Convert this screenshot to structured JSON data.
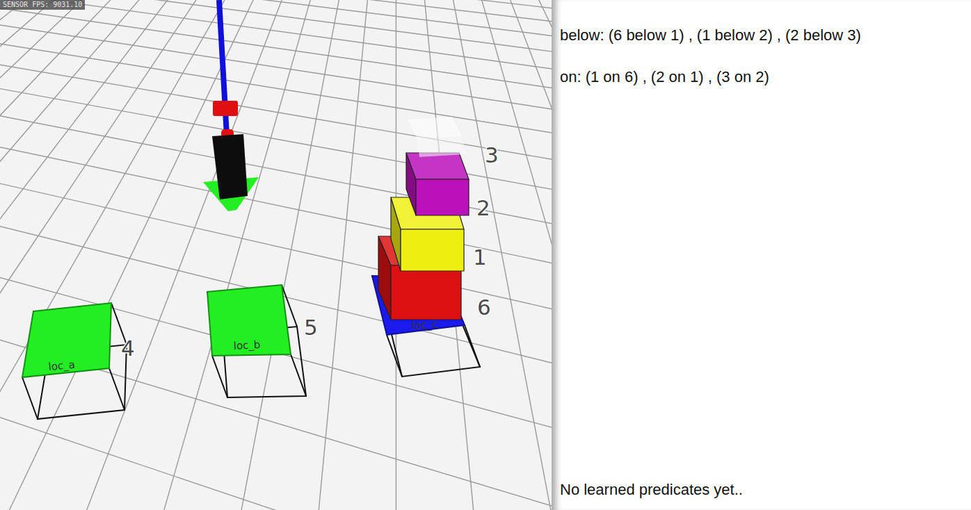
{
  "overlay": {
    "sensor_fps": "SENSOR FPS: 9031.10"
  },
  "scene": {
    "objects": [
      {
        "label": "4",
        "kind": "plate",
        "color": "#22ee22",
        "location": "loc_a"
      },
      {
        "label": "5",
        "kind": "plate",
        "color": "#22ee22",
        "location": "loc_b"
      },
      {
        "label": "6",
        "kind": "plate",
        "color": "#1a1aee",
        "location": "loc_c"
      },
      {
        "label": "1",
        "kind": "cube",
        "color": "#dd1111"
      },
      {
        "label": "2",
        "kind": "cube",
        "color": "#eeee11"
      },
      {
        "label": "3",
        "kind": "cube",
        "color": "#bb11bb"
      }
    ]
  },
  "panel": {
    "relations": [
      "below: (6 below 1) , (1 below 2) , (2 below 3)",
      "on: (1 on 6) , (2 on 1) , (3 on 2)"
    ],
    "learned_status": "No learned predicates yet.."
  }
}
